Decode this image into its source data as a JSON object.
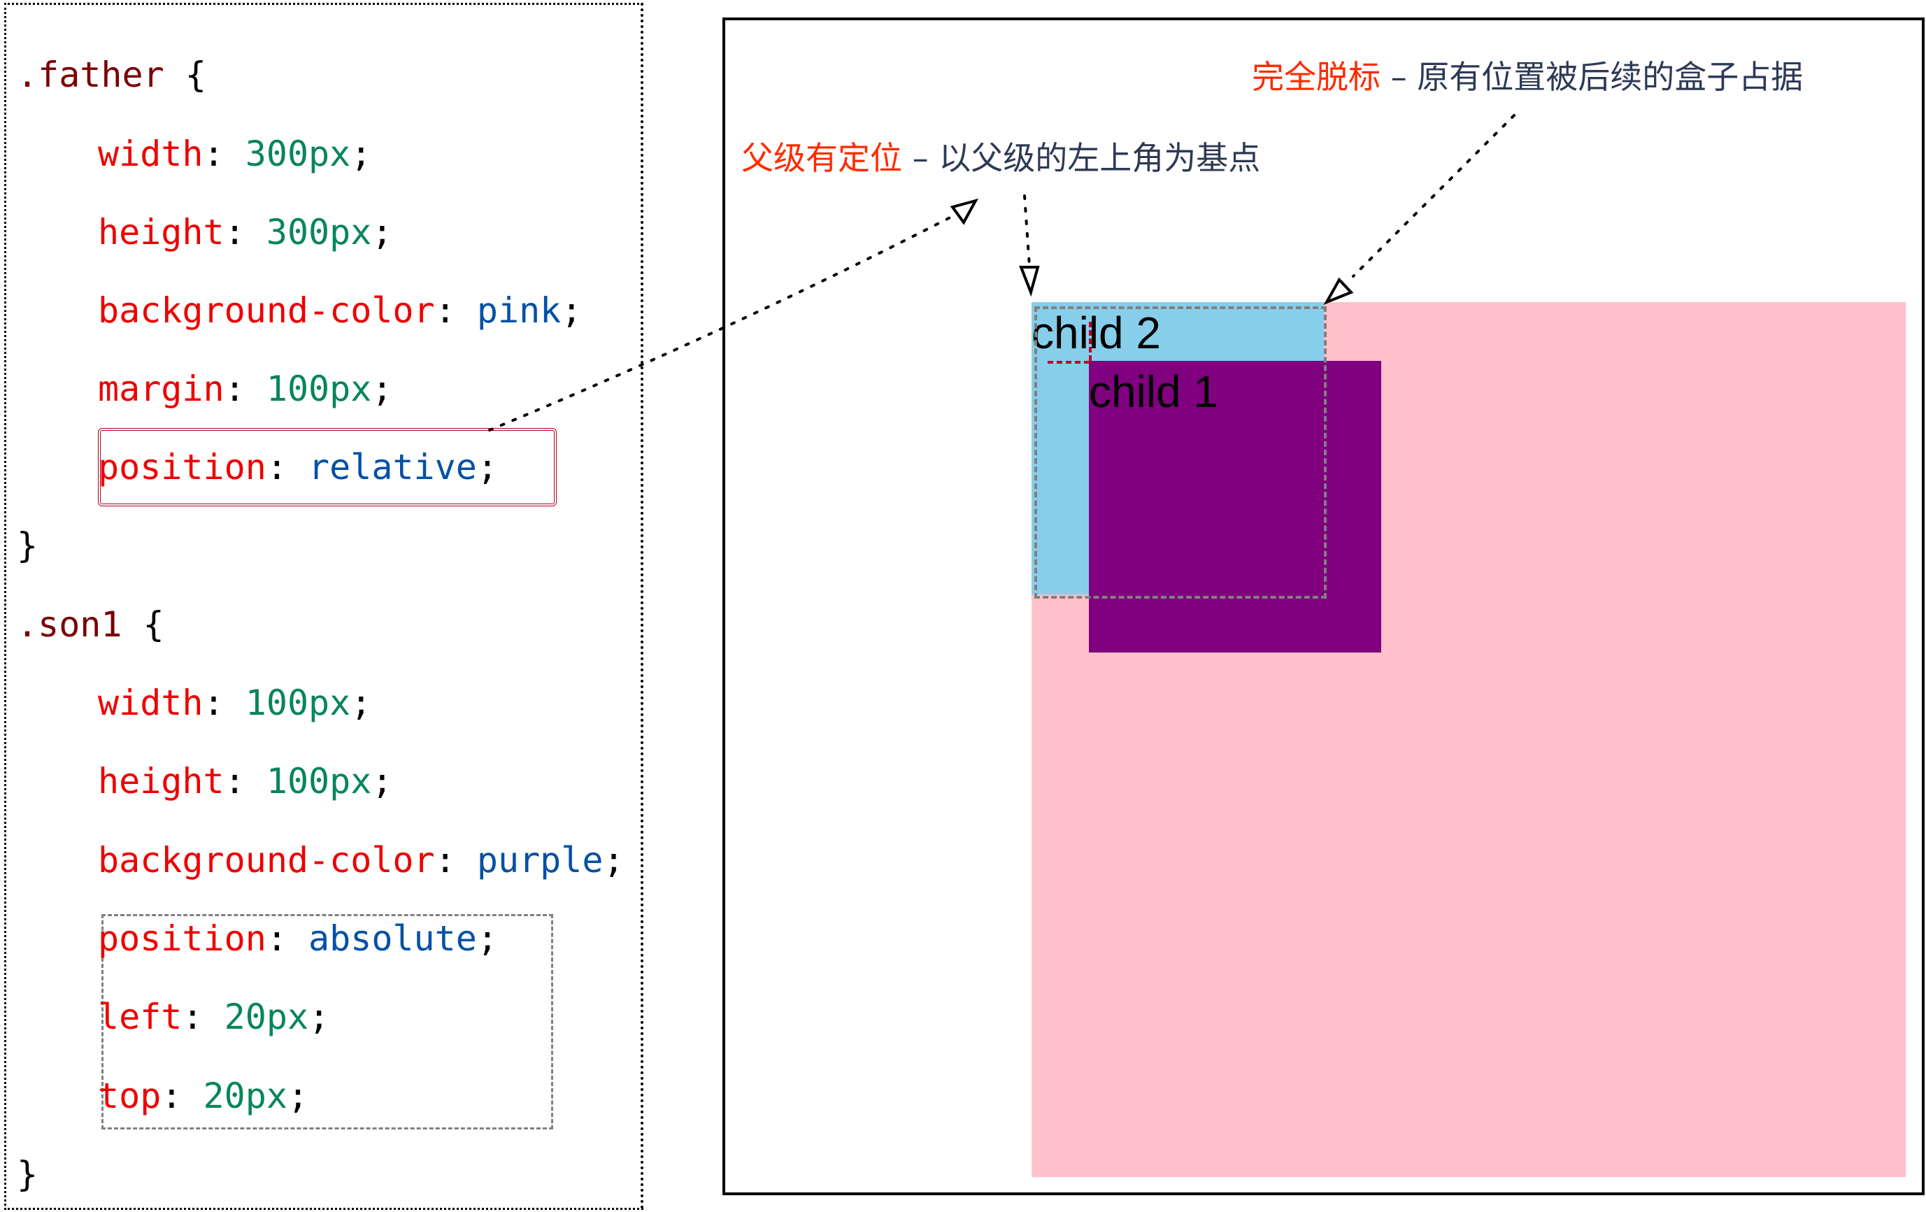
{
  "code": {
    "father": {
      "selector": ".father",
      "open_brace": "{",
      "close_brace": "}",
      "declarations": [
        {
          "prop": "width",
          "value": "300px",
          "value_type": "number"
        },
        {
          "prop": "height",
          "value": "300px",
          "value_type": "number"
        },
        {
          "prop": "background-color",
          "value": "pink",
          "value_type": "keyword"
        },
        {
          "prop": "margin",
          "value": "100px",
          "value_type": "number"
        },
        {
          "prop": "position",
          "value": "relative",
          "value_type": "keyword"
        }
      ]
    },
    "son1": {
      "selector": ".son1",
      "open_brace": "{",
      "close_brace": "}",
      "declarations": [
        {
          "prop": "width",
          "value": "100px",
          "value_type": "number"
        },
        {
          "prop": "height",
          "value": "100px",
          "value_type": "number"
        },
        {
          "prop": "background-color",
          "value": "purple",
          "value_type": "keyword"
        },
        {
          "prop": "position",
          "value": "absolute",
          "value_type": "keyword"
        },
        {
          "prop": "left",
          "value": "20px",
          "value_type": "number"
        },
        {
          "prop": "top",
          "value": "20px",
          "value_type": "number"
        }
      ]
    },
    "colon": ":",
    "semicolon": ";"
  },
  "demo": {
    "child2_label": "child 2",
    "child1_label": "child 1",
    "colors": {
      "father": "#ffc0cb",
      "child2": "#87ceeb",
      "child1": "#800080"
    }
  },
  "annotations": {
    "parent_positioned": {
      "highlight": "父级有定位",
      "rest": " – 以父级的左上角为基点"
    },
    "out_of_flow": {
      "highlight": "完全脱标",
      "rest": " – 原有位置被后续的盒子占据"
    }
  }
}
